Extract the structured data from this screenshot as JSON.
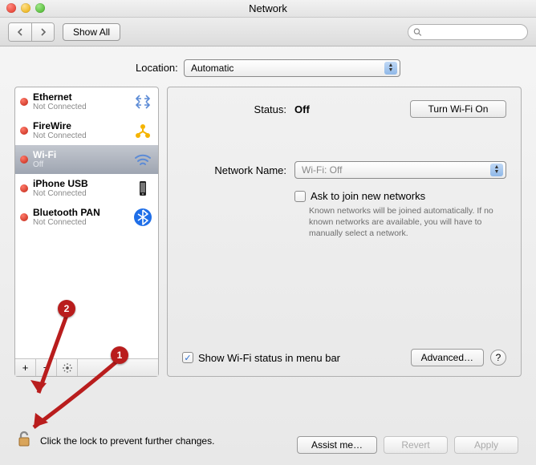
{
  "window": {
    "title": "Network"
  },
  "toolbar": {
    "showAll": "Show All",
    "searchPlaceholder": ""
  },
  "location": {
    "label": "Location:",
    "value": "Automatic"
  },
  "services": [
    {
      "name": "Ethernet",
      "sub": "Not Connected",
      "iconKey": "ethernet"
    },
    {
      "name": "FireWire",
      "sub": "Not Connected",
      "iconKey": "firewire"
    },
    {
      "name": "Wi-Fi",
      "sub": "Off",
      "iconKey": "wifi",
      "selected": true
    },
    {
      "name": "iPhone USB",
      "sub": "Not Connected",
      "iconKey": "iphone"
    },
    {
      "name": "Bluetooth PAN",
      "sub": "Not Connected",
      "iconKey": "bluetooth"
    }
  ],
  "detail": {
    "statusLabel": "Status:",
    "statusValue": "Off",
    "turnOn": "Turn Wi-Fi On",
    "networkNameLabel": "Network Name:",
    "networkNameValue": "Wi-Fi: Off",
    "askJoin": "Ask to join new networks",
    "hint": "Known networks will be joined automatically. If no known networks are available, you will have to manually select a network.",
    "showStatus": "Show Wi-Fi status in menu bar",
    "advanced": "Advanced…"
  },
  "footer": {
    "lockText": "Click the lock to prevent further changes.",
    "assist": "Assist me…",
    "revert": "Revert",
    "apply": "Apply"
  },
  "annotations": {
    "b1": "1",
    "b2": "2"
  }
}
